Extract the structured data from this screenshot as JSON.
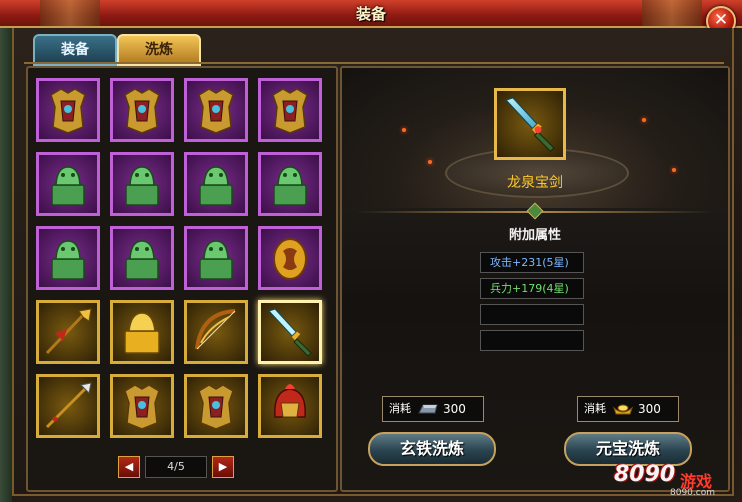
{
  "window": {
    "title": "装备",
    "close_label": "✕"
  },
  "tabs": [
    {
      "label": "装备",
      "active": false
    },
    {
      "label": "洗炼",
      "active": true
    }
  ],
  "grid": {
    "rows": [
      [
        {
          "item": "armor-icon",
          "rarity": "purple"
        },
        {
          "item": "armor-icon",
          "rarity": "purple"
        },
        {
          "item": "armor-icon",
          "rarity": "purple"
        },
        {
          "item": "armor-icon",
          "rarity": "purple"
        }
      ],
      [
        {
          "item": "jade-seal-icon",
          "rarity": "purple"
        },
        {
          "item": "jade-seal-icon",
          "rarity": "purple"
        },
        {
          "item": "jade-seal-icon",
          "rarity": "purple"
        },
        {
          "item": "jade-seal-icon",
          "rarity": "purple"
        }
      ],
      [
        {
          "item": "jade-seal-icon",
          "rarity": "purple"
        },
        {
          "item": "jade-seal-icon",
          "rarity": "purple"
        },
        {
          "item": "jade-seal-icon",
          "rarity": "purple"
        },
        {
          "item": "medallion-icon",
          "rarity": "purple"
        }
      ],
      [
        {
          "item": "polearm-icon",
          "rarity": "gold"
        },
        {
          "item": "gold-seal-icon",
          "rarity": "gold"
        },
        {
          "item": "bow-icon",
          "rarity": "gold"
        },
        {
          "item": "sword-icon",
          "rarity": "gold",
          "selected": true
        }
      ],
      [
        {
          "item": "spear-icon",
          "rarity": "gold"
        },
        {
          "item": "armor-icon",
          "rarity": "gold"
        },
        {
          "item": "armor-icon",
          "rarity": "gold"
        },
        {
          "item": "helmet-icon",
          "rarity": "gold"
        }
      ]
    ]
  },
  "pager": {
    "prev": "◀",
    "next": "▶",
    "text": "4/5"
  },
  "selected": {
    "name": "龙泉宝剑",
    "icon": "sword-icon"
  },
  "attributes": {
    "title": "附加属性",
    "lines": [
      "攻击+231(5星)",
      "兵力+179(4星)",
      "",
      ""
    ]
  },
  "costs": [
    {
      "label": "消耗",
      "icon": "iron-ingot-icon",
      "value": "300"
    },
    {
      "label": "消耗",
      "icon": "gold-ingot-icon",
      "value": "300"
    }
  ],
  "buttons": {
    "iron_refine": "玄铁洗炼",
    "gold_refine": "元宝洗炼"
  },
  "watermark": {
    "brand": "8090",
    "suffix": "游戏",
    "url": "8090.com"
  },
  "colors": {
    "selected_name": "#ffc826",
    "attr_attack": "#7ab8ff",
    "attr_troops": "#6fe06a",
    "title_bar": "#b02818"
  }
}
